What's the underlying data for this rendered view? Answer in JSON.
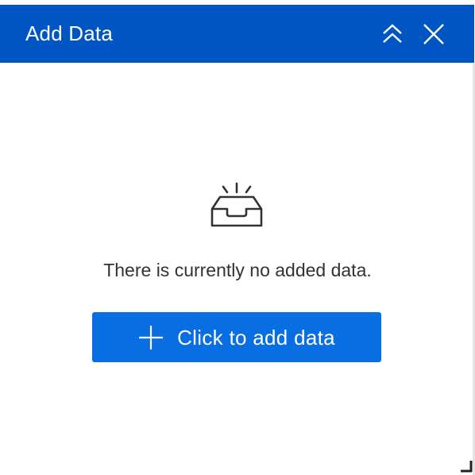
{
  "panel": {
    "title": "Add Data",
    "collapse_icon": "double-chevron-up-icon",
    "close_icon": "close-icon"
  },
  "empty_state": {
    "icon": "inbox-icon",
    "message": "There is currently no added data.",
    "button_icon": "plus-icon",
    "button_label": "Click to add data"
  },
  "colors": {
    "header_background": "#0055c4",
    "button_background": "#0a6ee3",
    "text": "#323232"
  }
}
